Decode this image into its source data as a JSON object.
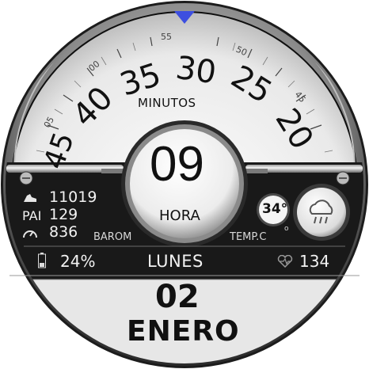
{
  "dial": {
    "minute_numbers": [
      "40",
      "35",
      "30",
      "25",
      "20"
    ],
    "partial_left": "45",
    "small_numbers": [
      "05",
      "00",
      "55",
      "50",
      "45"
    ],
    "label": "MINUTOS"
  },
  "hour": {
    "value": "09",
    "label": "HORA"
  },
  "stats": {
    "steps": "11019",
    "pai_label": "PAI",
    "pai": "129",
    "barom": "836",
    "barom_label": "BAROM",
    "temp_label": "TEMP.C",
    "temp_unit_mark": "o",
    "temp_value": "34°"
  },
  "weather": {
    "icon": "rain-cloud-icon"
  },
  "bottom_bar": {
    "battery": "24%",
    "day": "LUNES",
    "heart": "134"
  },
  "date": {
    "day": "02",
    "month": "ENERO"
  },
  "colors": {
    "marker": "#3d4fe0",
    "dial": "#f3f3f3",
    "panel": "#161616"
  }
}
